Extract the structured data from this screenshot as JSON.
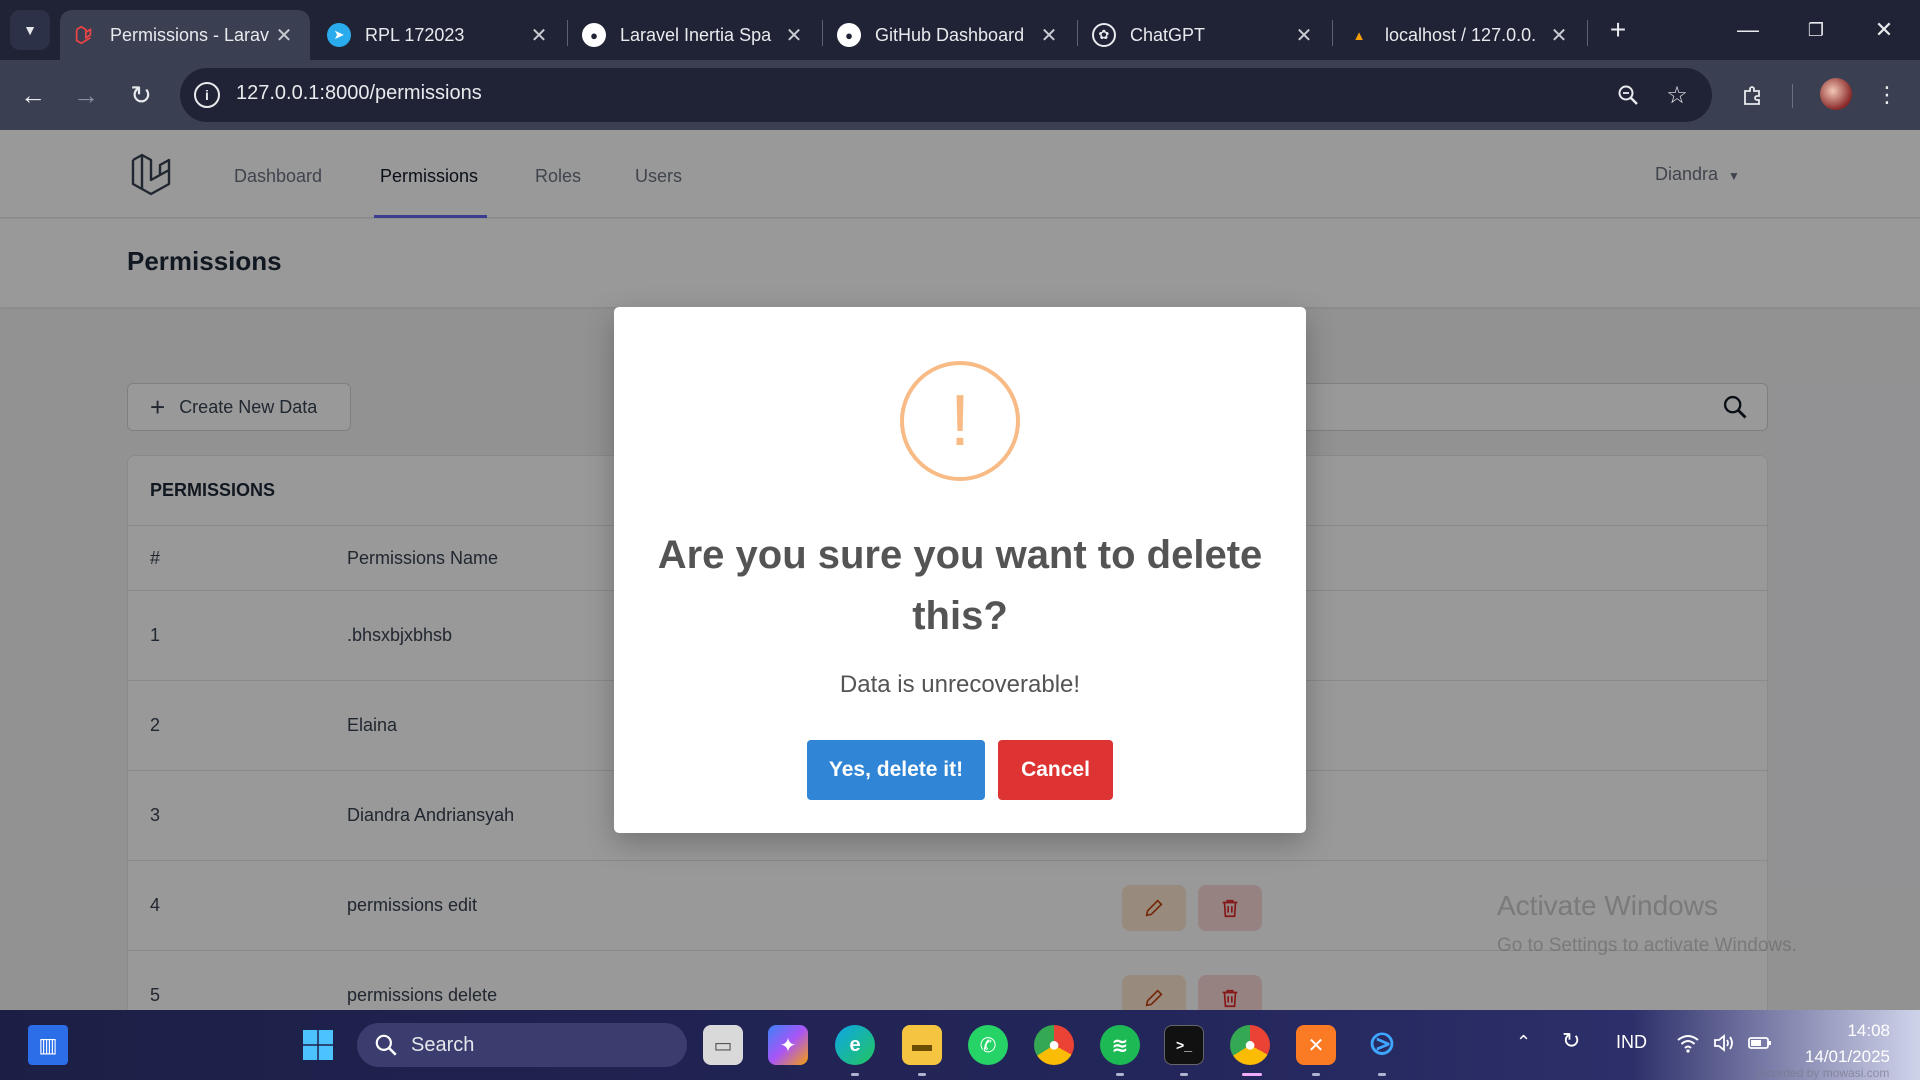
{
  "browser": {
    "tabs": [
      {
        "title": "Permissions - Larav",
        "favicon": "laravel-icon",
        "active": true
      },
      {
        "title": "RPL 172023",
        "favicon": "telegram-icon",
        "active": false
      },
      {
        "title": "Laravel Inertia Spa",
        "favicon": "github-icon",
        "active": false
      },
      {
        "title": "GitHub Dashboard",
        "favicon": "github-icon",
        "active": false
      },
      {
        "title": "ChatGPT",
        "favicon": "openai-icon",
        "active": false
      },
      {
        "title": "localhost / 127.0.0.",
        "favicon": "phpmyadmin-icon",
        "active": false
      }
    ],
    "url": "127.0.0.1:8000/permissions"
  },
  "app": {
    "nav": {
      "links": [
        "Dashboard",
        "Permissions",
        "Roles",
        "Users"
      ],
      "active": "Permissions",
      "user": "Diandra"
    },
    "page_title": "Permissions",
    "create_button": "Create New Data",
    "card_title": "PERMISSIONS",
    "table": {
      "headers": [
        "#",
        "Permissions Name"
      ],
      "rows": [
        {
          "num": "1",
          "name": ".bhsxbjxbhsb"
        },
        {
          "num": "2",
          "name": "Elaina"
        },
        {
          "num": "3",
          "name": "Diandra Andriansyah"
        },
        {
          "num": "4",
          "name": "permissions edit"
        },
        {
          "num": "5",
          "name": "permissions delete"
        }
      ]
    }
  },
  "modal": {
    "icon": "!",
    "title": "Are you sure you want to delete this?",
    "text": "Data is unrecoverable!",
    "confirm_label": "Yes, delete it!",
    "cancel_label": "Cancel"
  },
  "watermark": {
    "line1": "Activate Windows",
    "line2": "Go to Settings to activate Windows."
  },
  "taskbar": {
    "search_label": "Search",
    "language": "IND",
    "time": "14:08",
    "date": "14/01/2025",
    "recorded": "recorded by mowasi.com"
  },
  "colors": {
    "confirm": "#3085d6",
    "cancel": "#dd3333",
    "warning": "#f8bb86",
    "nav_active": "#6366f1"
  }
}
